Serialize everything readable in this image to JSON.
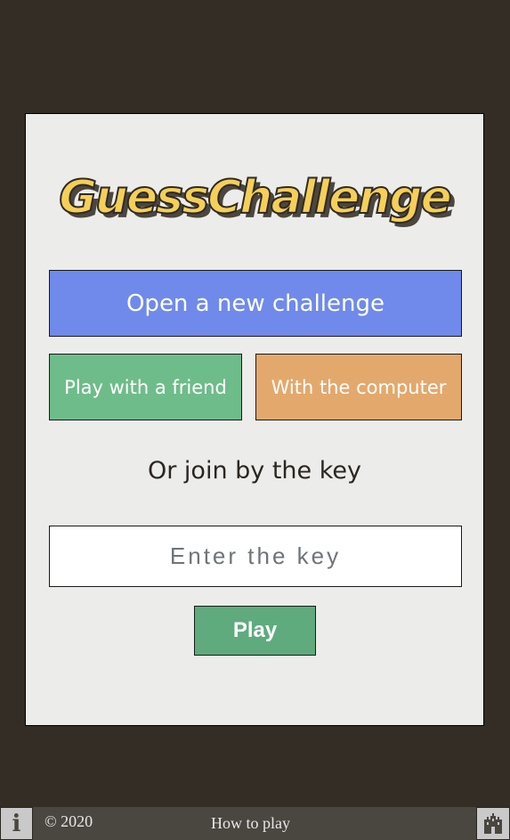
{
  "app": {
    "logo_text": "GuessChallenge"
  },
  "actions": {
    "new_challenge_label": "Open a new challenge",
    "friend_label": "Play with a friend",
    "computer_label": "With the computer"
  },
  "join": {
    "prompt": "Or join by the key",
    "key_placeholder": "Enter the key",
    "key_value": "",
    "play_label": "Play"
  },
  "footer": {
    "info_icon": "info-icon",
    "copyright": "© 2020",
    "how_to_play": "How to play",
    "castle_icon": "castle-icon"
  },
  "colors": {
    "background": "#332d25",
    "card": "#ececea",
    "logo": "#f5cf58",
    "new_challenge": "#6f8aea",
    "friend": "#6ebc8a",
    "computer": "#e3a86c",
    "play": "#5fab7d",
    "footer": "#4a4640"
  }
}
